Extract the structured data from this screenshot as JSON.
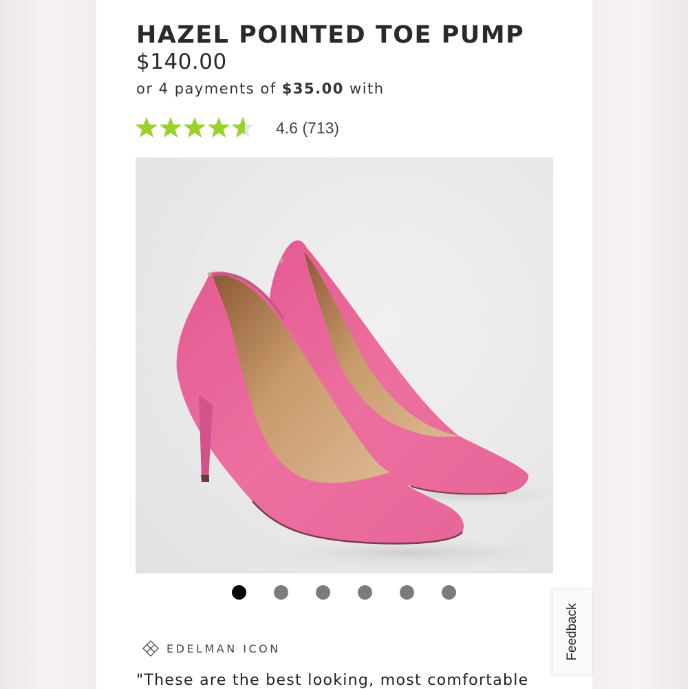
{
  "product": {
    "title": "HAZEL POINTED TOE PUMP",
    "price": "$140.00",
    "installments": {
      "prefix": "or 4 payments of",
      "amount": "$35.00",
      "suffix": "with"
    },
    "rating": {
      "value": "4.6",
      "count": "(713)",
      "stars_filled": 4.6,
      "stars_max": 5
    },
    "image": {
      "icon": "pink-suede-pumps-image",
      "colors": {
        "suede": "#e9679a",
        "lining": "#d9b48c",
        "background": "#ebeaea"
      }
    },
    "carousel": {
      "dot_count": 6,
      "active_index": 0
    },
    "collection": {
      "icon": "diamond-grid-icon",
      "label": "EDELMAN ICON"
    },
    "review_quote": "\"These are the best looking, most comfortable"
  },
  "feedback": {
    "label": "Feedback"
  },
  "colors": {
    "star_green": "#99d22a",
    "star_empty": "#e3e3e3",
    "dot_active": "#000000",
    "dot_inactive": "#7b7b7b"
  }
}
